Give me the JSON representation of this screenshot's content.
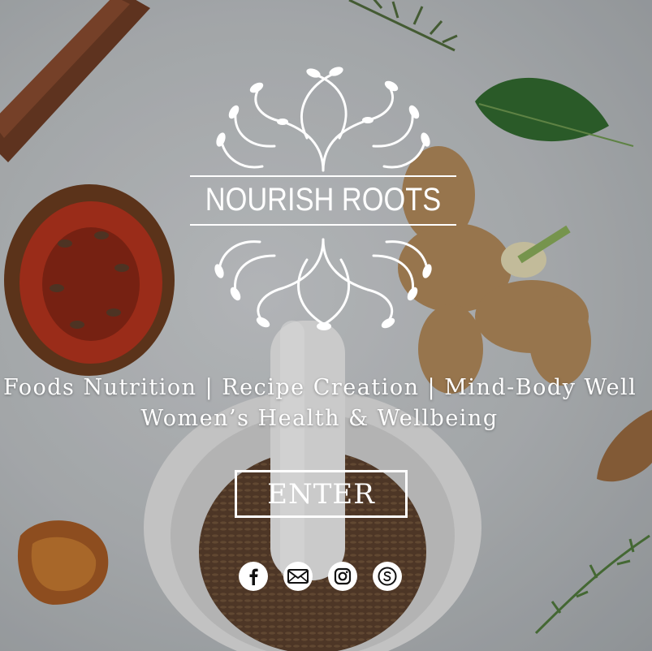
{
  "brand": {
    "name": "NOURISH ROOTS",
    "color_text": "#ffffff"
  },
  "tagline": {
    "line1": "Foods Nutrition | Recipe Creation | Mind-Body Well",
    "line2": "Women’s Health & Wellbeing"
  },
  "cta": {
    "enter_label": "ENTER"
  },
  "social": [
    {
      "icon": "facebook-icon"
    },
    {
      "icon": "email-icon"
    },
    {
      "icon": "instagram-icon"
    },
    {
      "icon": "skype-icon"
    }
  ],
  "colors": {
    "background": "#c9cdd0",
    "accent": "#ffffff"
  }
}
